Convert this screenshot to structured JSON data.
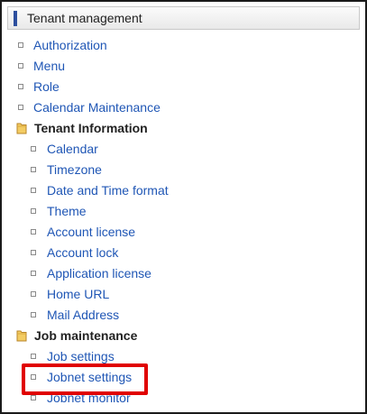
{
  "header": {
    "title": "Tenant management"
  },
  "menu": {
    "top_items": [
      "Authorization",
      "Menu",
      "Role",
      "Calendar Maintenance"
    ],
    "tenant_information": {
      "label": "Tenant Information",
      "items": [
        "Calendar",
        "Timezone",
        "Date and Time format",
        "Theme",
        "Account license",
        "Account lock",
        "Application license",
        "Home URL",
        "Mail Address"
      ]
    },
    "job_maintenance": {
      "label": "Job maintenance",
      "items": [
        "Job settings",
        "Jobnet settings",
        "Jobnet monitor"
      ]
    }
  },
  "colors": {
    "link": "#1f56b5",
    "header_accent": "#2d4f9e",
    "highlight": "#e00000",
    "folder": "#e8b84a"
  }
}
